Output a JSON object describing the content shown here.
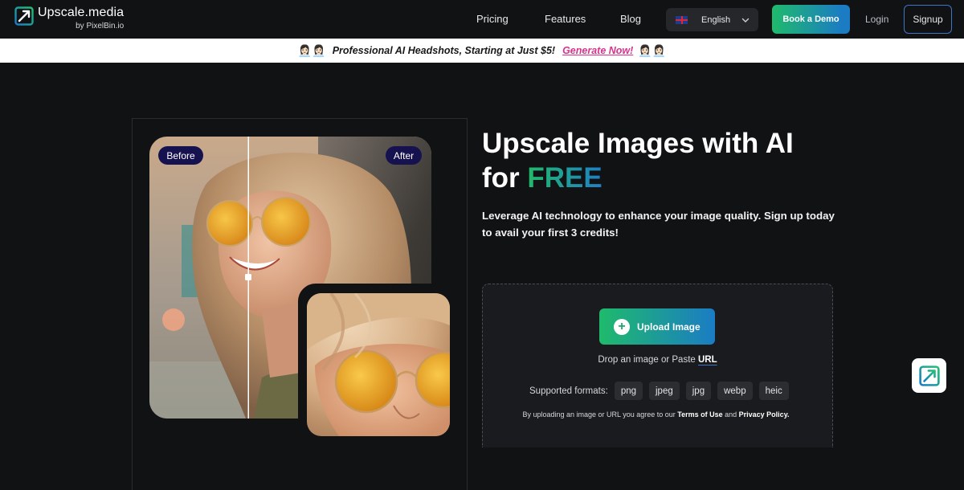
{
  "header": {
    "brand_name": "Upscale.media",
    "brand_sub": "by PixelBin.io",
    "nav": [
      "Pricing",
      "Features",
      "Blog"
    ],
    "language": "English",
    "book_demo": "Book a Demo",
    "login": "Login",
    "signup": "Signup"
  },
  "banner": {
    "emoji": "👩🏻‍💼👩🏻‍💼",
    "text": "Professional AI Headshots, Starting at Just $5!",
    "link": "Generate Now!"
  },
  "preview": {
    "before_label": "Before",
    "after_label": "After"
  },
  "hero": {
    "title_line1": "Upscale Images with AI",
    "title_for": "for ",
    "title_highlight": "FREE",
    "subtitle": "Leverage AI technology to enhance your image quality. Sign up today to avail your first 3 credits!"
  },
  "upload": {
    "button_label": "Upload Image",
    "drop_text": "Drop an image or Paste ",
    "url_link": "URL",
    "formats_label": "Supported formats:",
    "formats": [
      "png",
      "jpeg",
      "jpg",
      "webp",
      "heic"
    ],
    "terms_prefix": "By uploading an image or URL you agree to our ",
    "terms_link": "Terms of Use",
    "terms_and": " and ",
    "privacy_link": "Privacy Policy."
  },
  "colors": {
    "background": "#111214",
    "accent_green": "#1fba6c",
    "accent_blue": "#1b7cc4",
    "banner_link": "#d8338d",
    "tag_bg": "#16124f"
  }
}
